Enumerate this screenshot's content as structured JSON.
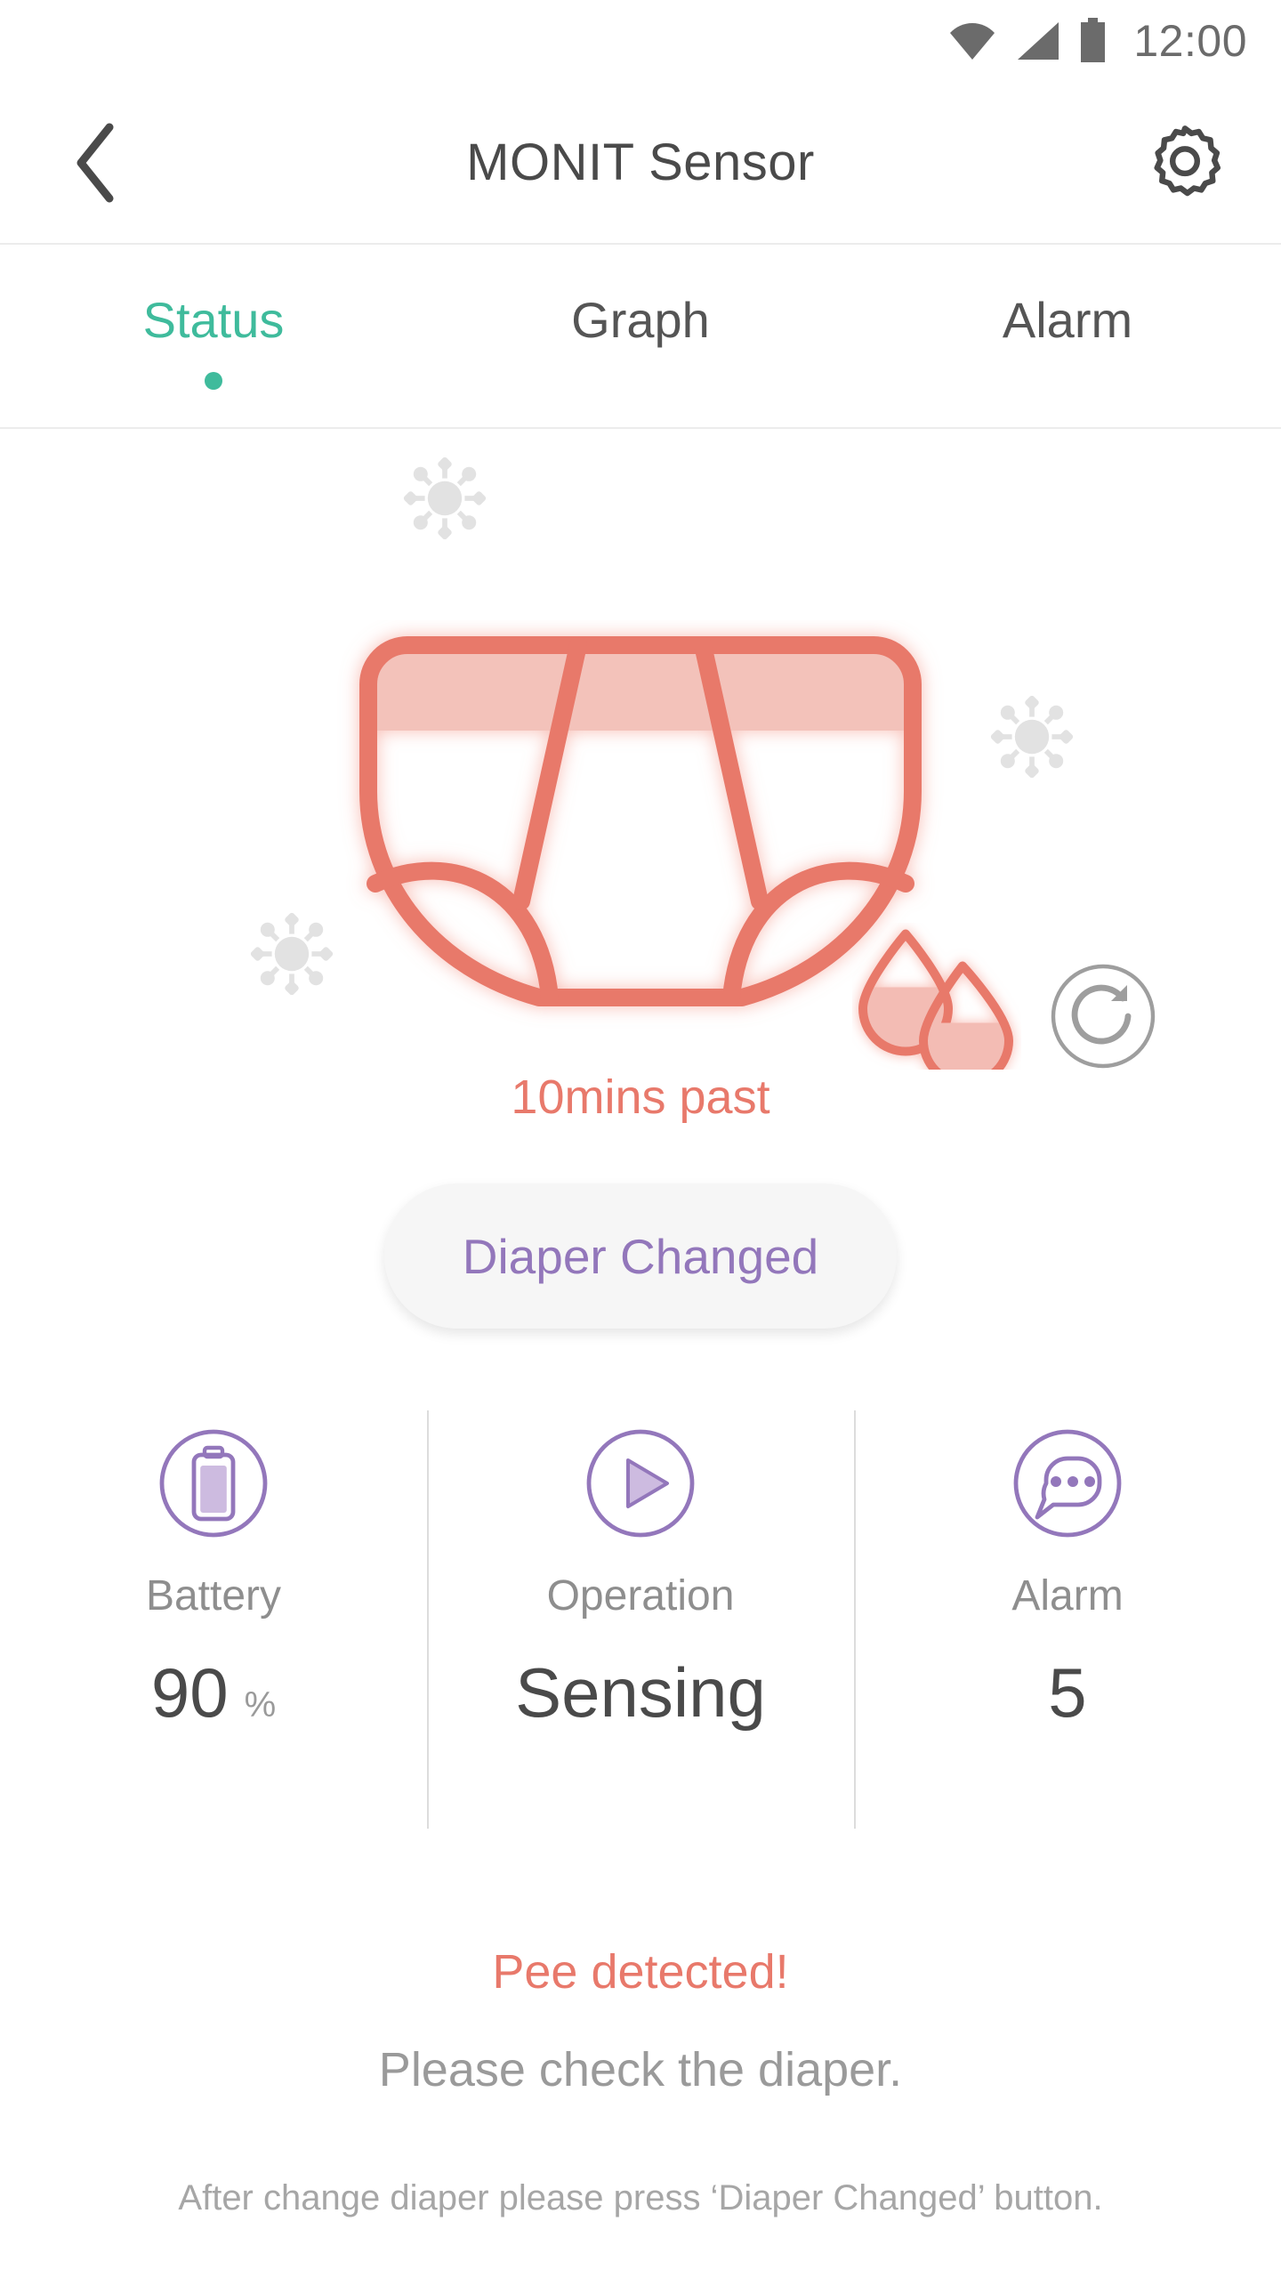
{
  "status_bar": {
    "wifi_icon": "wifi-icon",
    "signal_icon": "signal-icon",
    "battery_icon": "battery-icon",
    "time": "12:00"
  },
  "header": {
    "back_icon": "back-chevron-icon",
    "title": "MONIT Sensor",
    "settings_icon": "gear-icon"
  },
  "tabs": [
    {
      "label": "Status",
      "active": true
    },
    {
      "label": "Graph",
      "active": false
    },
    {
      "label": "Alarm",
      "active": false
    }
  ],
  "illustration": {
    "diaper_icon": "diaper-icon",
    "drops_icon": "water-drops-icon",
    "refresh_icon": "refresh-icon",
    "germ_icon": "germ-sparkle-icon",
    "elapsed_label": "10mins past"
  },
  "primary_action": {
    "label": "Diaper Changed"
  },
  "stats": [
    {
      "icon": "battery-circle-icon",
      "label": "Battery",
      "value": "90",
      "unit": "%"
    },
    {
      "icon": "play-circle-icon",
      "label": "Operation",
      "value": "Sensing",
      "unit": ""
    },
    {
      "icon": "speech-bubble-circle-icon",
      "label": "Alarm",
      "value": "5",
      "unit": ""
    }
  ],
  "messages": {
    "alert": "Pee detected!",
    "instruction": "Please check the diaper.",
    "footnote": "After change diaper please press ‘Diaper Changed’ button."
  },
  "colors": {
    "accent_teal": "#3fbb9c",
    "coral": "#e8796b",
    "coral_light": "#f3bcb4",
    "purple": "#9377bb",
    "purple_light": "#cdbbe0",
    "gray_text": "#9a9a9a",
    "dark_text": "#4a4a4a"
  }
}
